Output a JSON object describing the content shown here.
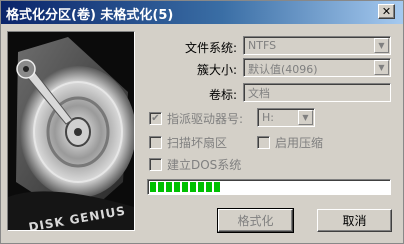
{
  "window": {
    "title": "格式化分区(卷) 未格式化(5)"
  },
  "form": {
    "filesystem": {
      "label": "文件系统:",
      "value": "NTFS"
    },
    "cluster": {
      "label": "簇大小:",
      "value": "默认值(4096)"
    },
    "volume": {
      "label": "卷标:",
      "value": "文档"
    },
    "assign_drive": {
      "label": "指派驱动器号:",
      "value": "H:",
      "checked": true
    },
    "scan_bad": {
      "label": "扫描坏扇区",
      "checked": false
    },
    "compress": {
      "label": "启用压缩",
      "checked": false
    },
    "create_dos": {
      "label": "建立DOS系统",
      "checked": false
    }
  },
  "progress": {
    "value": 0.3
  },
  "buttons": {
    "format": "格式化",
    "cancel": "取消"
  },
  "branding": {
    "text": "DISK GENIUS"
  },
  "icons": {
    "close": "close-icon",
    "dropdown": "chevron-down-icon",
    "check": "checkmark-icon"
  }
}
